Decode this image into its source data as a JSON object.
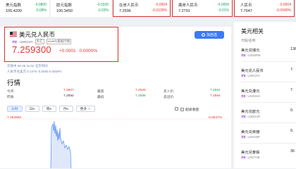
{
  "quotes": [
    {
      "name": "美元指数",
      "price": "105.4200",
      "chg": "-0.0800",
      "pct": "-0.08%",
      "color": "green"
    },
    {
      "name": "欧元指数",
      "price": "106.3450",
      "chg": "-0.0320",
      "pct": "-0.03%",
      "color": "green"
    },
    {
      "name": "在岸人民币",
      "price": "7.2596",
      "chg": "-0.0004",
      "pct": "-0.0100%",
      "color": "red"
    },
    {
      "name": "离岸人民币",
      "price": "7.2791",
      "chg": "-0.0009",
      "pct": "-0.01%",
      "color": "green"
    },
    {
      "name": "人民币",
      "price": "7.7947",
      "chg": "-0.0004",
      "pct": "-0.0040%",
      "color": "red"
    }
  ],
  "header": {
    "name": "美元兑人民币",
    "tag_fx": "FX",
    "tag_code": "USDCNY",
    "tag_spot": "外汇",
    "tag_level": "Level1基础行情",
    "price": "7.259300",
    "change": "+0.0001",
    "change_pct": "0.0000%",
    "time": "交易中 06-25 11:02 北京时间",
    "ref": "人民币兑美元 0.1378 -0.0000 0.0000%",
    "add_label": "加自选"
  },
  "market": {
    "title": "行情",
    "rows": [
      [
        {
          "label": "今开",
          "value": "7.2607",
          "c": "red"
        },
        {
          "label": "最高",
          "value": "7.2629",
          "c": "red"
        },
        {
          "label": "买入价",
          "value": "7.2591",
          "c": "green"
        }
      ],
      [
        {
          "label": "昨收",
          "value": "7.2592",
          "c": ""
        },
        {
          "label": "最低",
          "value": "7.2586",
          "c": "green"
        },
        {
          "label": "卖出价",
          "value": "7.2594",
          "c": "red"
        }
      ]
    ]
  },
  "tabs": [
    "分时",
    "日K",
    "周K",
    "月K",
    "更多"
  ],
  "tabs_active": "分时",
  "more_suffix": "⌄",
  "toggle_label": "超级看图",
  "chart": {
    "top_price": "7.262800",
    "top_pct": "0.0037%",
    "colors": {
      "line": "#3a7bf5",
      "fill": "#dfe8fb"
    }
  },
  "side": {
    "title": "美元相关",
    "head_left": "代码/名称",
    "head_right": "",
    "items": [
      {
        "name": "美元兑瑞元",
        "code": "USDBRM",
        "fx": "FX",
        "value": "136"
      },
      {
        "name": "美元兑人民币",
        "code": "USDCNY",
        "fx": "FX",
        "value": "7."
      },
      {
        "name": "美元兑港元",
        "code": "USDHKD",
        "fx": "FX",
        "value": "7."
      },
      {
        "name": "美元兑欧元",
        "code": "USDEUR",
        "fx": "FX",
        "value": "0."
      },
      {
        "name": "美元兑英镑",
        "code": "USDGBP",
        "fx": "FX",
        "value": "0."
      },
      {
        "name": "美元兑泰铢",
        "code": "USDTHB",
        "fx": "FX",
        "value": "36"
      }
    ]
  }
}
